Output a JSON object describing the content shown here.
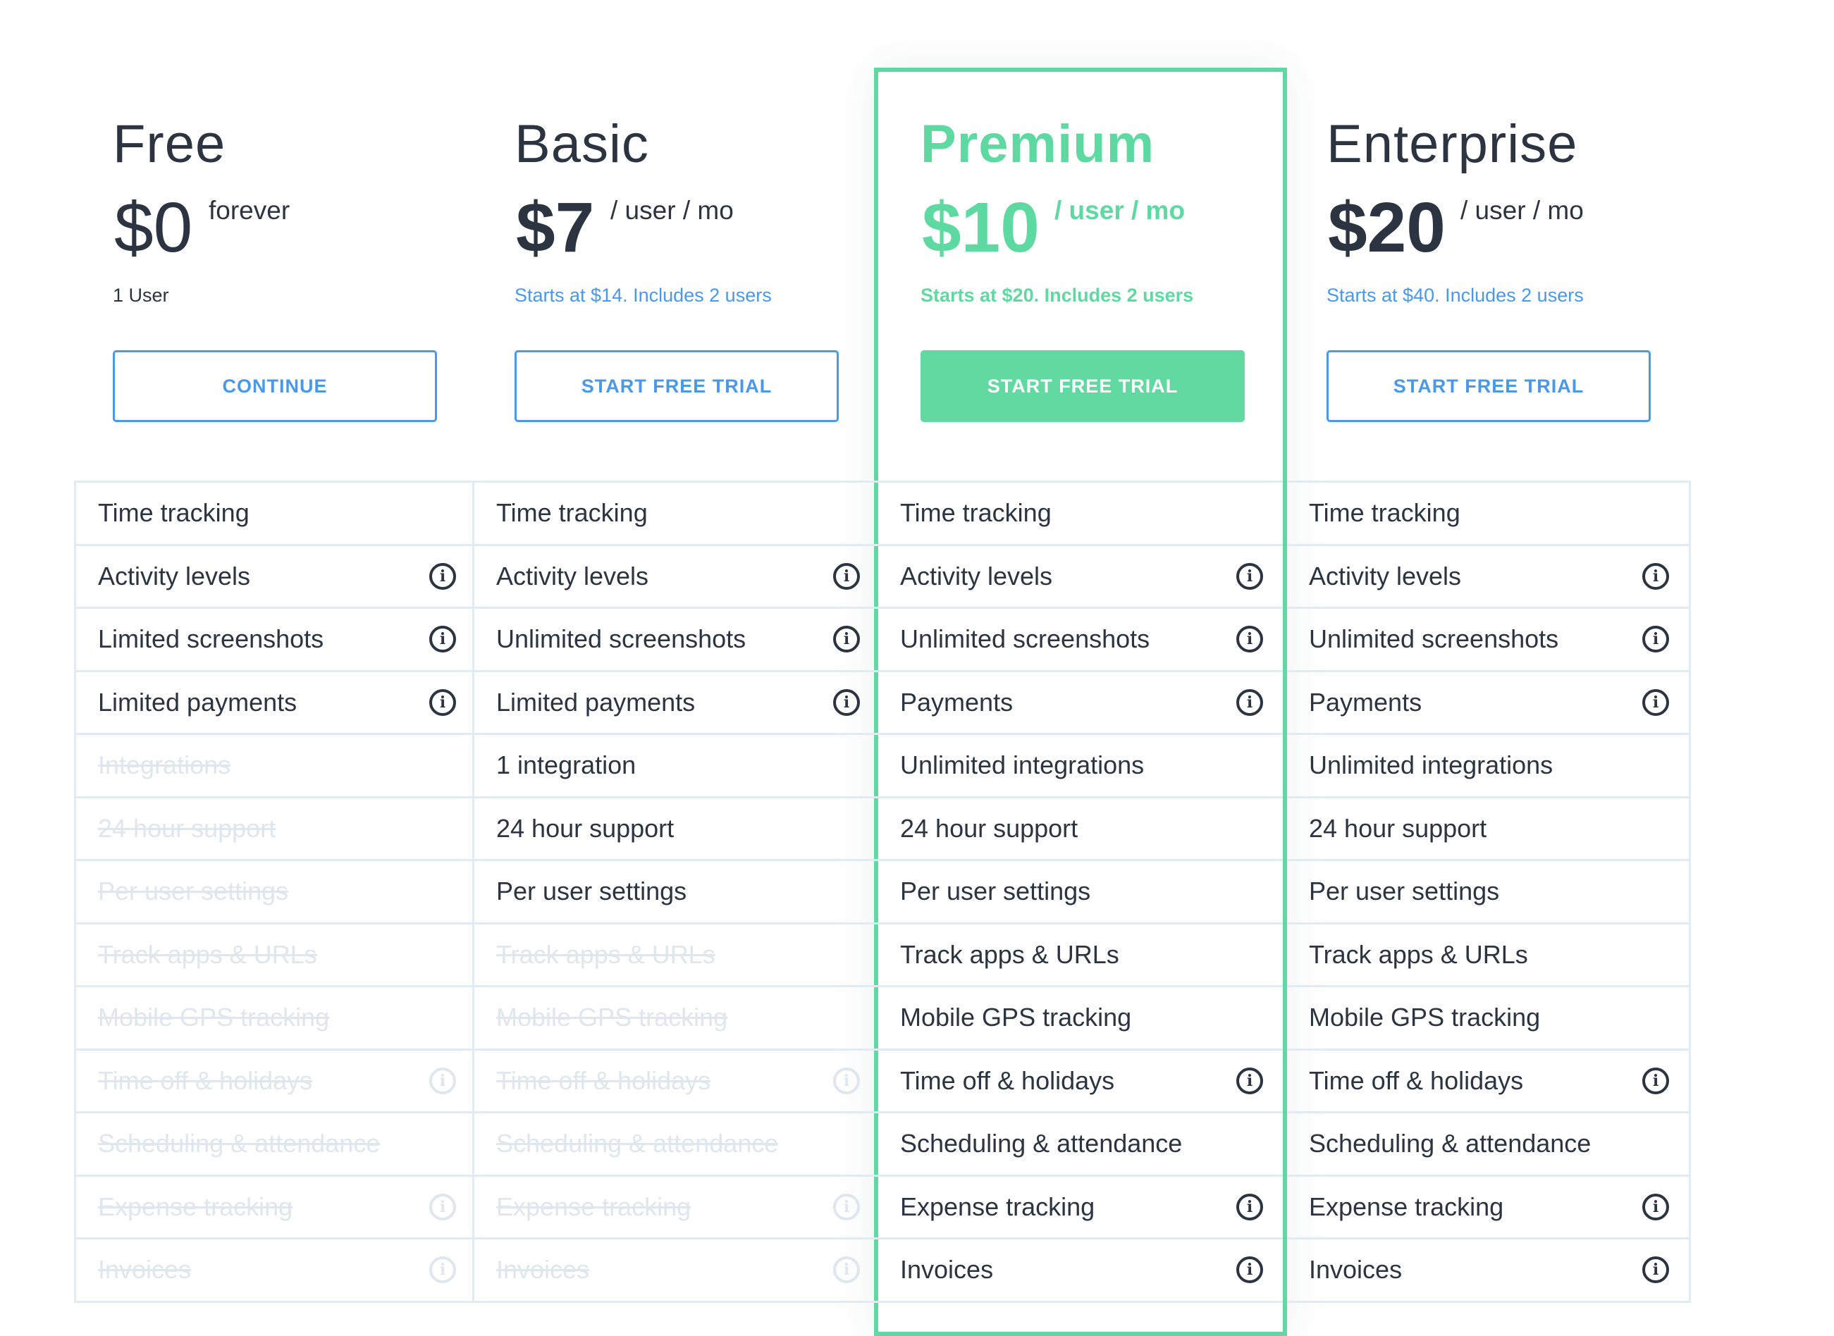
{
  "plans": [
    {
      "name": "Free",
      "price": "$0",
      "period": "forever",
      "note": "1 User",
      "button": "CONTINUE",
      "features": [
        {
          "label": "Time tracking",
          "info": false,
          "enabled": true
        },
        {
          "label": "Activity levels",
          "info": true,
          "enabled": true
        },
        {
          "label": "Limited screenshots",
          "info": true,
          "enabled": true
        },
        {
          "label": "Limited payments",
          "info": true,
          "enabled": true
        },
        {
          "label": "Integrations",
          "info": false,
          "enabled": false
        },
        {
          "label": "24 hour support",
          "info": false,
          "enabled": false
        },
        {
          "label": "Per user settings",
          "info": false,
          "enabled": false
        },
        {
          "label": "Track apps & URLs",
          "info": false,
          "enabled": false
        },
        {
          "label": "Mobile GPS tracking",
          "info": false,
          "enabled": false
        },
        {
          "label": "Time off & holidays",
          "info": true,
          "enabled": false
        },
        {
          "label": "Scheduling & attendance",
          "info": false,
          "enabled": false
        },
        {
          "label": "Expense tracking",
          "info": true,
          "enabled": false
        },
        {
          "label": "Invoices",
          "info": true,
          "enabled": false
        }
      ]
    },
    {
      "name": "Basic",
      "price": "$7",
      "period": "/ user / mo",
      "note": "Starts at $14. Includes 2 users",
      "button": "START FREE TRIAL",
      "features": [
        {
          "label": "Time tracking",
          "info": false,
          "enabled": true
        },
        {
          "label": "Activity levels",
          "info": true,
          "enabled": true
        },
        {
          "label": "Unlimited screenshots",
          "info": true,
          "enabled": true
        },
        {
          "label": "Limited payments",
          "info": true,
          "enabled": true
        },
        {
          "label": "1 integration",
          "info": false,
          "enabled": true
        },
        {
          "label": "24 hour support",
          "info": false,
          "enabled": true
        },
        {
          "label": "Per user settings",
          "info": false,
          "enabled": true
        },
        {
          "label": "Track apps & URLs",
          "info": false,
          "enabled": false
        },
        {
          "label": "Mobile GPS tracking",
          "info": false,
          "enabled": false
        },
        {
          "label": "Time off & holidays",
          "info": true,
          "enabled": false
        },
        {
          "label": "Scheduling & attendance",
          "info": false,
          "enabled": false
        },
        {
          "label": "Expense tracking",
          "info": true,
          "enabled": false
        },
        {
          "label": "Invoices",
          "info": true,
          "enabled": false
        }
      ]
    },
    {
      "name": "Premium",
      "price": "$10",
      "period": "/ user / mo",
      "note": "Starts at $20. Includes 2 users",
      "button": "START FREE TRIAL",
      "features": [
        {
          "label": "Time tracking",
          "info": false,
          "enabled": true
        },
        {
          "label": "Activity levels",
          "info": true,
          "enabled": true
        },
        {
          "label": "Unlimited screenshots",
          "info": true,
          "enabled": true
        },
        {
          "label": "Payments",
          "info": true,
          "enabled": true
        },
        {
          "label": "Unlimited integrations",
          "info": false,
          "enabled": true
        },
        {
          "label": "24 hour support",
          "info": false,
          "enabled": true
        },
        {
          "label": "Per user settings",
          "info": false,
          "enabled": true
        },
        {
          "label": "Track apps & URLs",
          "info": false,
          "enabled": true
        },
        {
          "label": "Mobile GPS tracking",
          "info": false,
          "enabled": true
        },
        {
          "label": "Time off & holidays",
          "info": true,
          "enabled": true
        },
        {
          "label": "Scheduling & attendance",
          "info": false,
          "enabled": true
        },
        {
          "label": "Expense tracking",
          "info": true,
          "enabled": true
        },
        {
          "label": "Invoices",
          "info": true,
          "enabled": true
        }
      ]
    },
    {
      "name": "Enterprise",
      "price": "$20",
      "period": "/ user / mo",
      "note": "Starts at $40. Includes 2 users",
      "button": "START FREE TRIAL",
      "features": [
        {
          "label": "Time tracking",
          "info": false,
          "enabled": true
        },
        {
          "label": "Activity levels",
          "info": true,
          "enabled": true
        },
        {
          "label": "Unlimited screenshots",
          "info": true,
          "enabled": true
        },
        {
          "label": "Payments",
          "info": true,
          "enabled": true
        },
        {
          "label": "Unlimited integrations",
          "info": false,
          "enabled": true
        },
        {
          "label": "24 hour support",
          "info": false,
          "enabled": true
        },
        {
          "label": "Per user settings",
          "info": false,
          "enabled": true
        },
        {
          "label": "Track apps & URLs",
          "info": false,
          "enabled": true
        },
        {
          "label": "Mobile GPS tracking",
          "info": false,
          "enabled": true
        },
        {
          "label": "Time off & holidays",
          "info": true,
          "enabled": true
        },
        {
          "label": "Scheduling & attendance",
          "info": false,
          "enabled": true
        },
        {
          "label": "Expense tracking",
          "info": true,
          "enabled": true
        },
        {
          "label": "Invoices",
          "info": true,
          "enabled": true
        }
      ]
    }
  ],
  "info_icon_glyph": "i",
  "colors": {
    "accent_green": "#63d9a2",
    "link_blue": "#4a98e9",
    "text_dark": "#2b3440",
    "border": "#e2ebf4",
    "disabled_text": "#dfe6ee"
  }
}
